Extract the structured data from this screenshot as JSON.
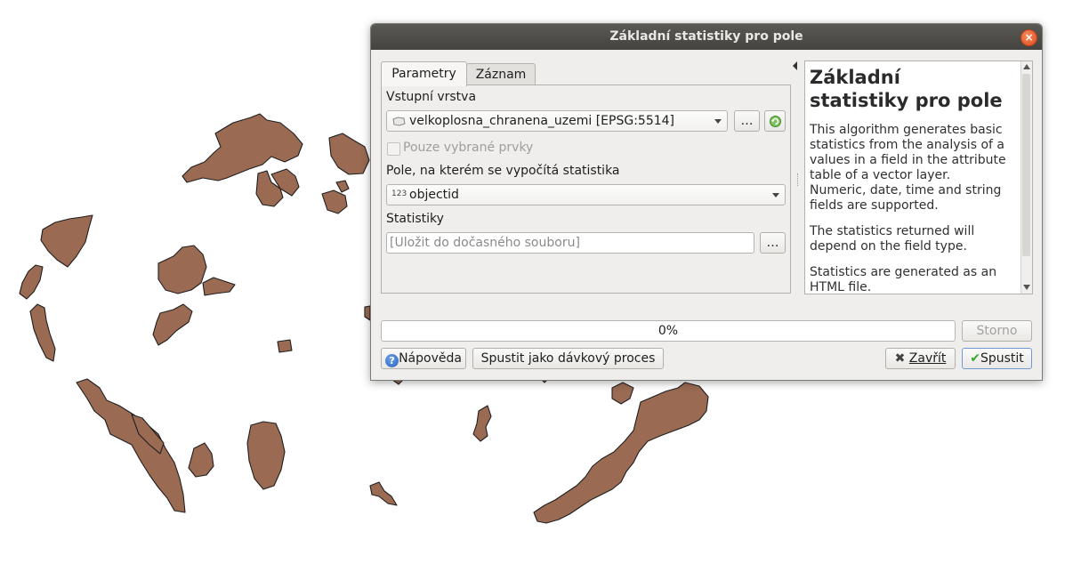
{
  "dialog": {
    "title": "Základní statistiky pro pole",
    "close_icon": "close-icon"
  },
  "tabs": [
    {
      "label": "Parametry",
      "active": true
    },
    {
      "label": "Záznam",
      "active": false
    }
  ],
  "params": {
    "input_layer_label": "Vstupní vrstva",
    "input_layer_value": "velkoplosna_chranena_uzemi [EPSG:5514]",
    "input_layer_icon": "polygon-layer-icon",
    "browse_label": "…",
    "iterate_icon": "iterate-icon",
    "selected_only_label": "Pouze vybrané prvky",
    "selected_only_checked": false,
    "field_label": "Pole, na kterém se vypočítá statistika",
    "field_type_badge": "123",
    "field_value": "objectid",
    "output_label": "Statistiky",
    "output_placeholder": "[Uložit do dočasného souboru]",
    "output_browse_label": "…"
  },
  "help": {
    "title": "Základní statistiky pro pole",
    "paragraphs": [
      "This algorithm generates basic statistics from the analysis of a values in a field in the attribute table of a vector layer. Numeric, date, time and string fields are supported.",
      "The statistics returned will depend on the field type.",
      "Statistics are generated as an HTML file."
    ]
  },
  "progress": {
    "value_percent": 0,
    "text": "0%"
  },
  "buttons": {
    "cancel": "Storno",
    "help": "Nápověda",
    "batch": "Spustit jako dávkový proces",
    "close": "Zavřít",
    "run": "Spustit"
  },
  "colors": {
    "polygon_fill": "#9a6a52",
    "titlebar": "#4e4d49",
    "close_button": "#e85a2c"
  }
}
